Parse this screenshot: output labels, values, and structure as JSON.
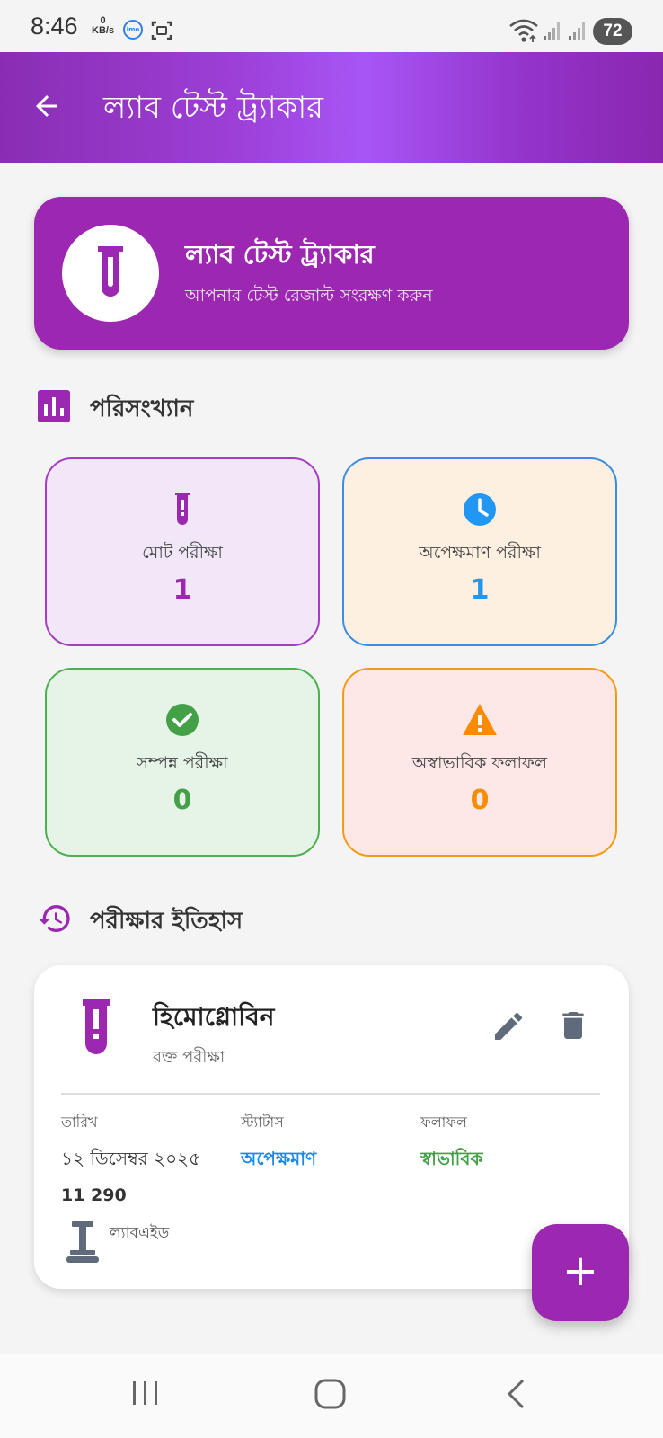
{
  "status_bar": {
    "time": "8:46",
    "speed_value": "0",
    "speed_unit": "KB/s",
    "imo": "imo",
    "battery": "72"
  },
  "app_bar": {
    "title": "ল্যাব টেস্ট ট্র্যাকার"
  },
  "hero": {
    "title": "ল্যাব টেস্ট ট্র্যাকার",
    "subtitle": "আপনার টেস্ট রেজাল্ট সংরক্ষণ করুন"
  },
  "stats_section": {
    "title": "পরিসংখ্যান"
  },
  "stats": {
    "total": {
      "label": "মোট পরীক্ষা",
      "value": "1",
      "color": "#9c27b0"
    },
    "pending": {
      "label": "অপেক্ষমাণ পরীক্ষা",
      "value": "1",
      "color": "#2196f3"
    },
    "completed": {
      "label": "সম্পন্ন পরীক্ষা",
      "value": "0",
      "color": "#43a047"
    },
    "abnormal": {
      "label": "অস্বাভাবিক ফলাফল",
      "value": "0",
      "color": "#fb8c00"
    }
  },
  "history_section": {
    "title": "পরীক্ষার ইতিহাস"
  },
  "history": {
    "test_name": "হিমোগ্লোবিন",
    "test_type": "রক্ত পরীক্ষা",
    "date_label": "তারিখ",
    "date_value": "১২ ডিসেম্বর ২০২৫",
    "status_label": "স্ট্যাটাস",
    "status_value": "অপেক্ষমাণ",
    "result_label": "ফলাফল",
    "result_value": "স্বাভাবিক",
    "value": "11 290",
    "lab": "ল্যাবএইড"
  },
  "fab": {
    "label": "+"
  },
  "colors": {
    "primary": "#9c27b0",
    "pending": "#1e88e5",
    "normal": "#43a047"
  },
  "icons": {
    "back": "arrow-left-icon",
    "test_tube": "test-tube-icon",
    "bar_chart": "bar-chart-icon",
    "clock": "clock-icon",
    "check": "check-circle-icon",
    "warning": "warning-icon",
    "history": "history-icon",
    "edit": "pencil-icon",
    "delete": "trash-icon",
    "lab": "lab-stand-icon"
  }
}
